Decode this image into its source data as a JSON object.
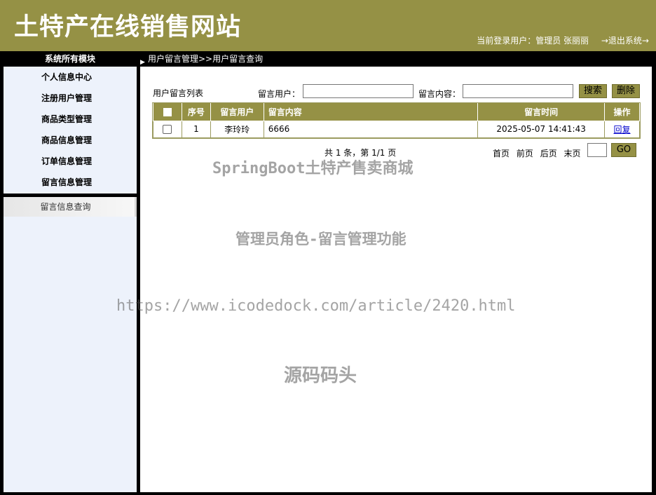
{
  "header": {
    "site_title": "土特产在线销售网站",
    "current_user_text": "当前登录用户：管理员 张丽丽",
    "logout_label": "→退出系统→"
  },
  "nav": {
    "modules_title": "系统所有模块",
    "breadcrumb": "用户留言管理>>用户留言查询",
    "breadcrumb_icon": "triangle-right-icon"
  },
  "sidebar": {
    "items": [
      {
        "label": "个人信息中心"
      },
      {
        "label": "注册用户管理"
      },
      {
        "label": "商品类型管理"
      },
      {
        "label": "商品信息管理"
      },
      {
        "label": "订单信息管理"
      },
      {
        "label": "留言信息管理"
      }
    ],
    "submenu": {
      "label": "留言信息查询"
    }
  },
  "toolbar": {
    "list_title": "用户留言列表",
    "user_label": "留言用户：",
    "user_value": "",
    "content_label": "留言内容：",
    "content_value": "",
    "search_label": "搜索",
    "delete_label": "删除"
  },
  "table": {
    "headers": {
      "index": "序号",
      "user": "留言用户",
      "content": "留言内容",
      "time": "留言时间",
      "action": "操作"
    },
    "rows": [
      {
        "index": "1",
        "user": "李玲玲",
        "content": "6666",
        "time": "2025-05-07 14:41:43",
        "action": "回复"
      }
    ]
  },
  "pager": {
    "summary": "共 1 条，第 1/1 页",
    "first": "首页",
    "prev": "前页",
    "next": "后页",
    "last": "末页",
    "go_value": "",
    "go_label": "GO"
  },
  "watermarks": {
    "line1": "SpringBoot土特产售卖商城",
    "line2": "管理员角色-留言管理功能",
    "line3": "https://www.icodedock.com/article/2420.html",
    "line4": "源码码头"
  },
  "colors": {
    "accent": "#959145",
    "sidebar_bg": "#edf2fb",
    "frame": "#000000"
  }
}
